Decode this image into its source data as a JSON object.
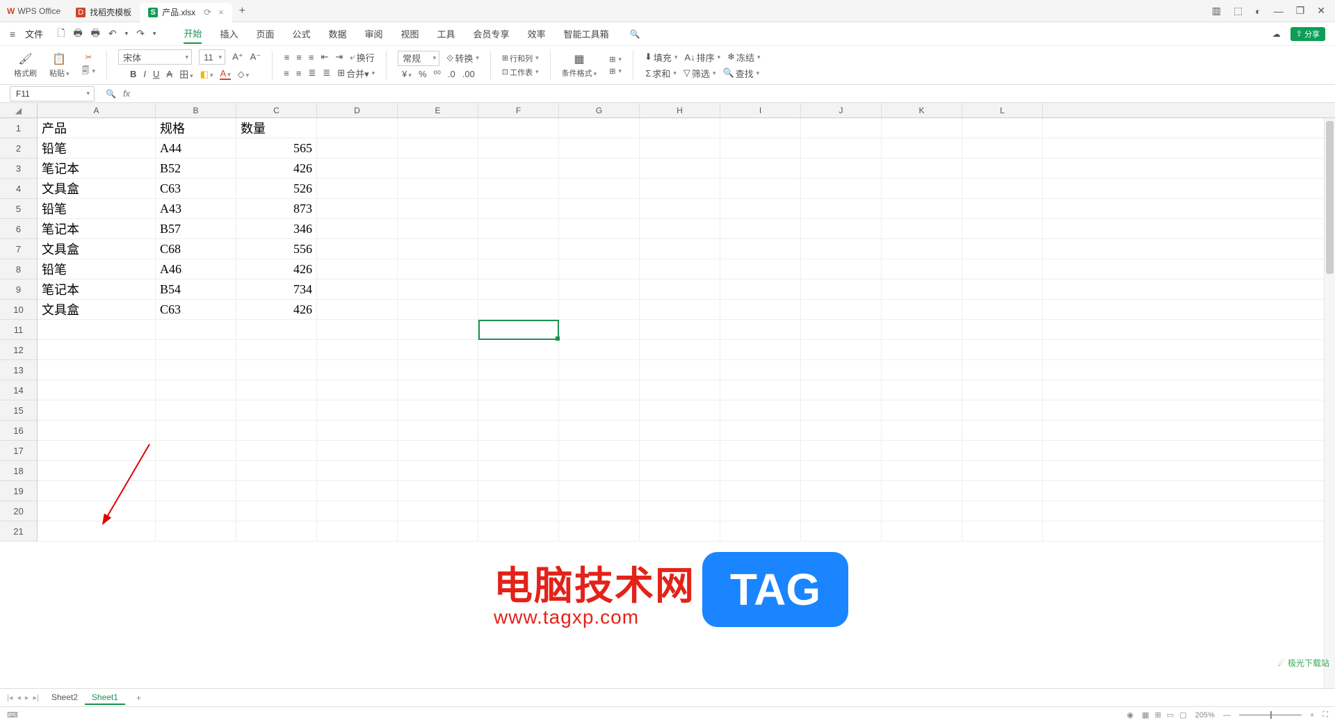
{
  "titlebar": {
    "app_name": "WPS Office",
    "tab1_label": "找稻壳模板",
    "tab2_label": "产品.xlsx",
    "tab2_sync": "⟳",
    "tab2_close": "×",
    "plus": "+",
    "win": {
      "layout": "▥",
      "box": "⬚",
      "avatar": "◐",
      "min": "—",
      "max": "❐",
      "close": "✕"
    }
  },
  "menubar": {
    "burger": "≡",
    "file": "文件",
    "qat": {
      "save": "🗋",
      "print": "🖶",
      "preview": "🖶",
      "undo": "↶",
      "dd": "▾",
      "redo": "↷",
      "dd2": "▾"
    },
    "tabs": [
      "开始",
      "插入",
      "页面",
      "公式",
      "数据",
      "审阅",
      "视图",
      "工具",
      "会员专享",
      "效率",
      "智能工具箱"
    ],
    "active_tab": "开始",
    "search": "🔍",
    "cloud": "☁",
    "share_label": "分享"
  },
  "ribbon": {
    "format_painter": "格式刷",
    "paste": "粘贴",
    "cut": "✂",
    "font_name": "宋体",
    "font_size": "11",
    "grow": "A⁺",
    "shrink": "A⁻",
    "bold": "B",
    "italic": "I",
    "underline": "U",
    "strike": "A",
    "border": "田",
    "fill": "◧",
    "textcolor": "A",
    "more": "◇",
    "align_tl": "≡",
    "align_tc": "≡",
    "align_tr": "≡",
    "wrap": "⤶",
    "wrap_label": "换行",
    "align_bl": "≡",
    "align_bc": "≡",
    "align_br": "≣",
    "merge": "⊞",
    "merge_label": "合并▾",
    "numfmt": "常规",
    "convfmt": "转换",
    "currency": "¥",
    "percent": "%",
    "comma": "⁰⁰",
    "dec_inc": ".0",
    "dec_dec": ".00",
    "rowscols": "行和列",
    "worksheet": "工作表",
    "condfmt": "条件格式",
    "tblstyle": "⊞",
    "fillcmd": "填充",
    "sortcmd": "排序",
    "freeze": "冻结",
    "sum": "求和",
    "filter": "筛选",
    "find": "查找"
  },
  "namebox": {
    "ref": "F11",
    "zoom": "🔍",
    "fx": "fx"
  },
  "columns": [
    "A",
    "B",
    "C",
    "D",
    "E",
    "F",
    "G",
    "H",
    "I",
    "J",
    "K",
    "L"
  ],
  "rows": [
    1,
    2,
    3,
    4,
    5,
    6,
    7,
    8,
    9,
    10,
    11,
    12,
    13,
    14,
    15,
    16,
    17,
    18,
    19,
    20,
    21
  ],
  "data": {
    "header": {
      "A": "产品",
      "B": "规格",
      "C": "数量"
    },
    "rows": [
      {
        "A": "铅笔",
        "B": "A44",
        "C": 565
      },
      {
        "A": "笔记本",
        "B": "B52",
        "C": 426
      },
      {
        "A": "文具盒",
        "B": "C63",
        "C": 526
      },
      {
        "A": "铅笔",
        "B": "A43",
        "C": 873
      },
      {
        "A": "笔记本",
        "B": "B57",
        "C": 346
      },
      {
        "A": "文具盒",
        "B": "C68",
        "C": 556
      },
      {
        "A": "铅笔",
        "B": "A46",
        "C": 426
      },
      {
        "A": "笔记本",
        "B": "B54",
        "C": 734
      },
      {
        "A": "文具盒",
        "B": "C63",
        "C": 426
      }
    ]
  },
  "selection": {
    "col": "F",
    "row": 11
  },
  "watermark": {
    "text": "电脑技术网",
    "url": "www.tagxp.com",
    "tag": "TAG",
    "dl": "极光下载站"
  },
  "sheetbar": {
    "nav": [
      "|◂",
      "◂",
      "▸",
      "▸|"
    ],
    "sheets": [
      "Sheet2",
      "Sheet1"
    ],
    "active": "Sheet1",
    "add": "+"
  },
  "statusbar": {
    "mode": "⌨",
    "eye": "◉",
    "views": [
      "▦",
      "⊞",
      "▭",
      "▢"
    ],
    "zoom": "205%",
    "minus": "—",
    "plus": "+",
    "expand": "⛶"
  }
}
